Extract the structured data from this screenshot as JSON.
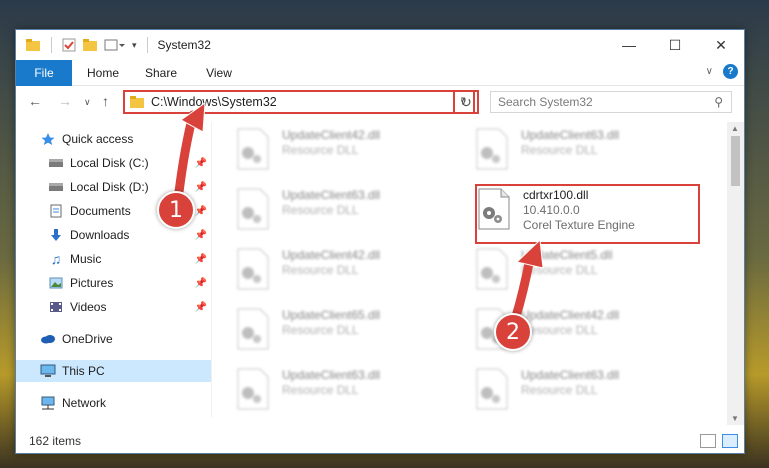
{
  "window": {
    "title": "System32"
  },
  "ribbon": {
    "tabs": [
      "File",
      "Home",
      "Share",
      "View"
    ]
  },
  "address": {
    "path": "C:\\Windows\\System32"
  },
  "search": {
    "placeholder": "Search System32"
  },
  "nav": {
    "items": [
      {
        "label": "Quick access",
        "icon": "star-icon",
        "pinned": false
      },
      {
        "label": "Local Disk (C:)",
        "icon": "drive-icon",
        "pinned": true
      },
      {
        "label": "Local Disk (D:)",
        "icon": "drive-icon",
        "pinned": true
      },
      {
        "label": "Documents",
        "icon": "documents-icon",
        "pinned": true
      },
      {
        "label": "Downloads",
        "icon": "download-icon",
        "pinned": true
      },
      {
        "label": "Music",
        "icon": "music-icon",
        "pinned": true
      },
      {
        "label": "Pictures",
        "icon": "pictures-icon",
        "pinned": true
      },
      {
        "label": "Videos",
        "icon": "videos-icon",
        "pinned": true
      },
      {
        "label": "OneDrive",
        "icon": "cloud-icon",
        "pinned": false
      },
      {
        "label": "This PC",
        "icon": "computer-icon",
        "pinned": false,
        "selected": true
      },
      {
        "label": "Network",
        "icon": "network-icon",
        "pinned": false
      }
    ]
  },
  "files": [
    {
      "name": "UpdateClient42.dll",
      "type": "Resource DLL"
    },
    {
      "name": "UpdateClient63.dll",
      "type": "Resource DLL"
    },
    {
      "name": "UpdateClient63.dll",
      "type": "Resource DLL"
    },
    {
      "name": "cdrtxr100.dll",
      "version": "10.410.0.0",
      "type": "Corel Texture Engine",
      "highlighted": true
    },
    {
      "name": "UpdateClient42.dll",
      "type": "Resource DLL"
    },
    {
      "name": "UpdateClient5.dll",
      "type": "Resource DLL"
    },
    {
      "name": "UpdateClient65.dll",
      "type": "Resource DLL"
    },
    {
      "name": "UpdateClient42.dll",
      "type": "Resource DLL"
    },
    {
      "name": "UpdateClient63.dll",
      "type": "Resource DLL"
    },
    {
      "name": "UpdateClient63.dll",
      "type": "Resource DLL"
    }
  ],
  "status": {
    "count": "162 items"
  },
  "annotations": {
    "step1": "1",
    "step2": "2",
    "color": "#d9423b"
  }
}
